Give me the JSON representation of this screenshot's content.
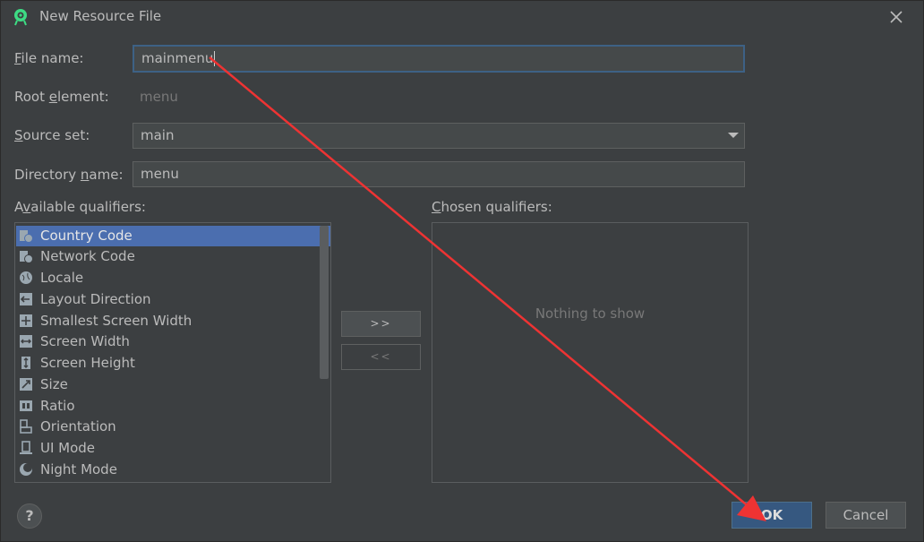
{
  "window": {
    "title": "New Resource File",
    "app_icon": "android-studio-icon",
    "close_icon": "close-icon"
  },
  "form": {
    "file_name_label_pre": "",
    "file_name_label_u": "F",
    "file_name_label_post": "ile name:",
    "file_name_value": "mainmenu",
    "root_element_label_pre": "Root ",
    "root_element_label_u": "e",
    "root_element_label_post": "lement:",
    "root_element_value": "menu",
    "source_set_label_pre": "",
    "source_set_label_u": "S",
    "source_set_label_post": "ource set:",
    "source_set_value": "main",
    "directory_label_pre": "Directory ",
    "directory_label_u": "n",
    "directory_label_post": "ame:",
    "directory_value": "menu"
  },
  "qualifiers": {
    "available_label_pre": "A",
    "available_label_u": "v",
    "available_label_post": "ailable qualifiers:",
    "chosen_label_pre": "",
    "chosen_label_u": "C",
    "chosen_label_post": "hosen qualifiers:",
    "items": [
      {
        "label": "Country Code",
        "icon": "country-code-icon"
      },
      {
        "label": "Network Code",
        "icon": "network-code-icon"
      },
      {
        "label": "Locale",
        "icon": "globe-icon"
      },
      {
        "label": "Layout Direction",
        "icon": "layout-direction-icon"
      },
      {
        "label": "Smallest Screen Width",
        "icon": "smallest-width-icon"
      },
      {
        "label": "Screen Width",
        "icon": "screen-width-icon"
      },
      {
        "label": "Screen Height",
        "icon": "screen-height-icon"
      },
      {
        "label": "Size",
        "icon": "size-icon"
      },
      {
        "label": "Ratio",
        "icon": "ratio-icon"
      },
      {
        "label": "Orientation",
        "icon": "orientation-icon"
      },
      {
        "label": "UI Mode",
        "icon": "ui-mode-icon"
      },
      {
        "label": "Night Mode",
        "icon": "night-mode-icon"
      }
    ],
    "selected_index": 0,
    "add_button": ">>",
    "remove_button": "<<",
    "empty_text": "Nothing to show"
  },
  "footer": {
    "help_label": "?",
    "ok_label": "OK",
    "cancel_label": "Cancel"
  },
  "colors": {
    "background": "#3c3f41",
    "selection": "#4b6eaf",
    "ok_button": "#365880",
    "annotation_arrow": "#ee3333"
  }
}
